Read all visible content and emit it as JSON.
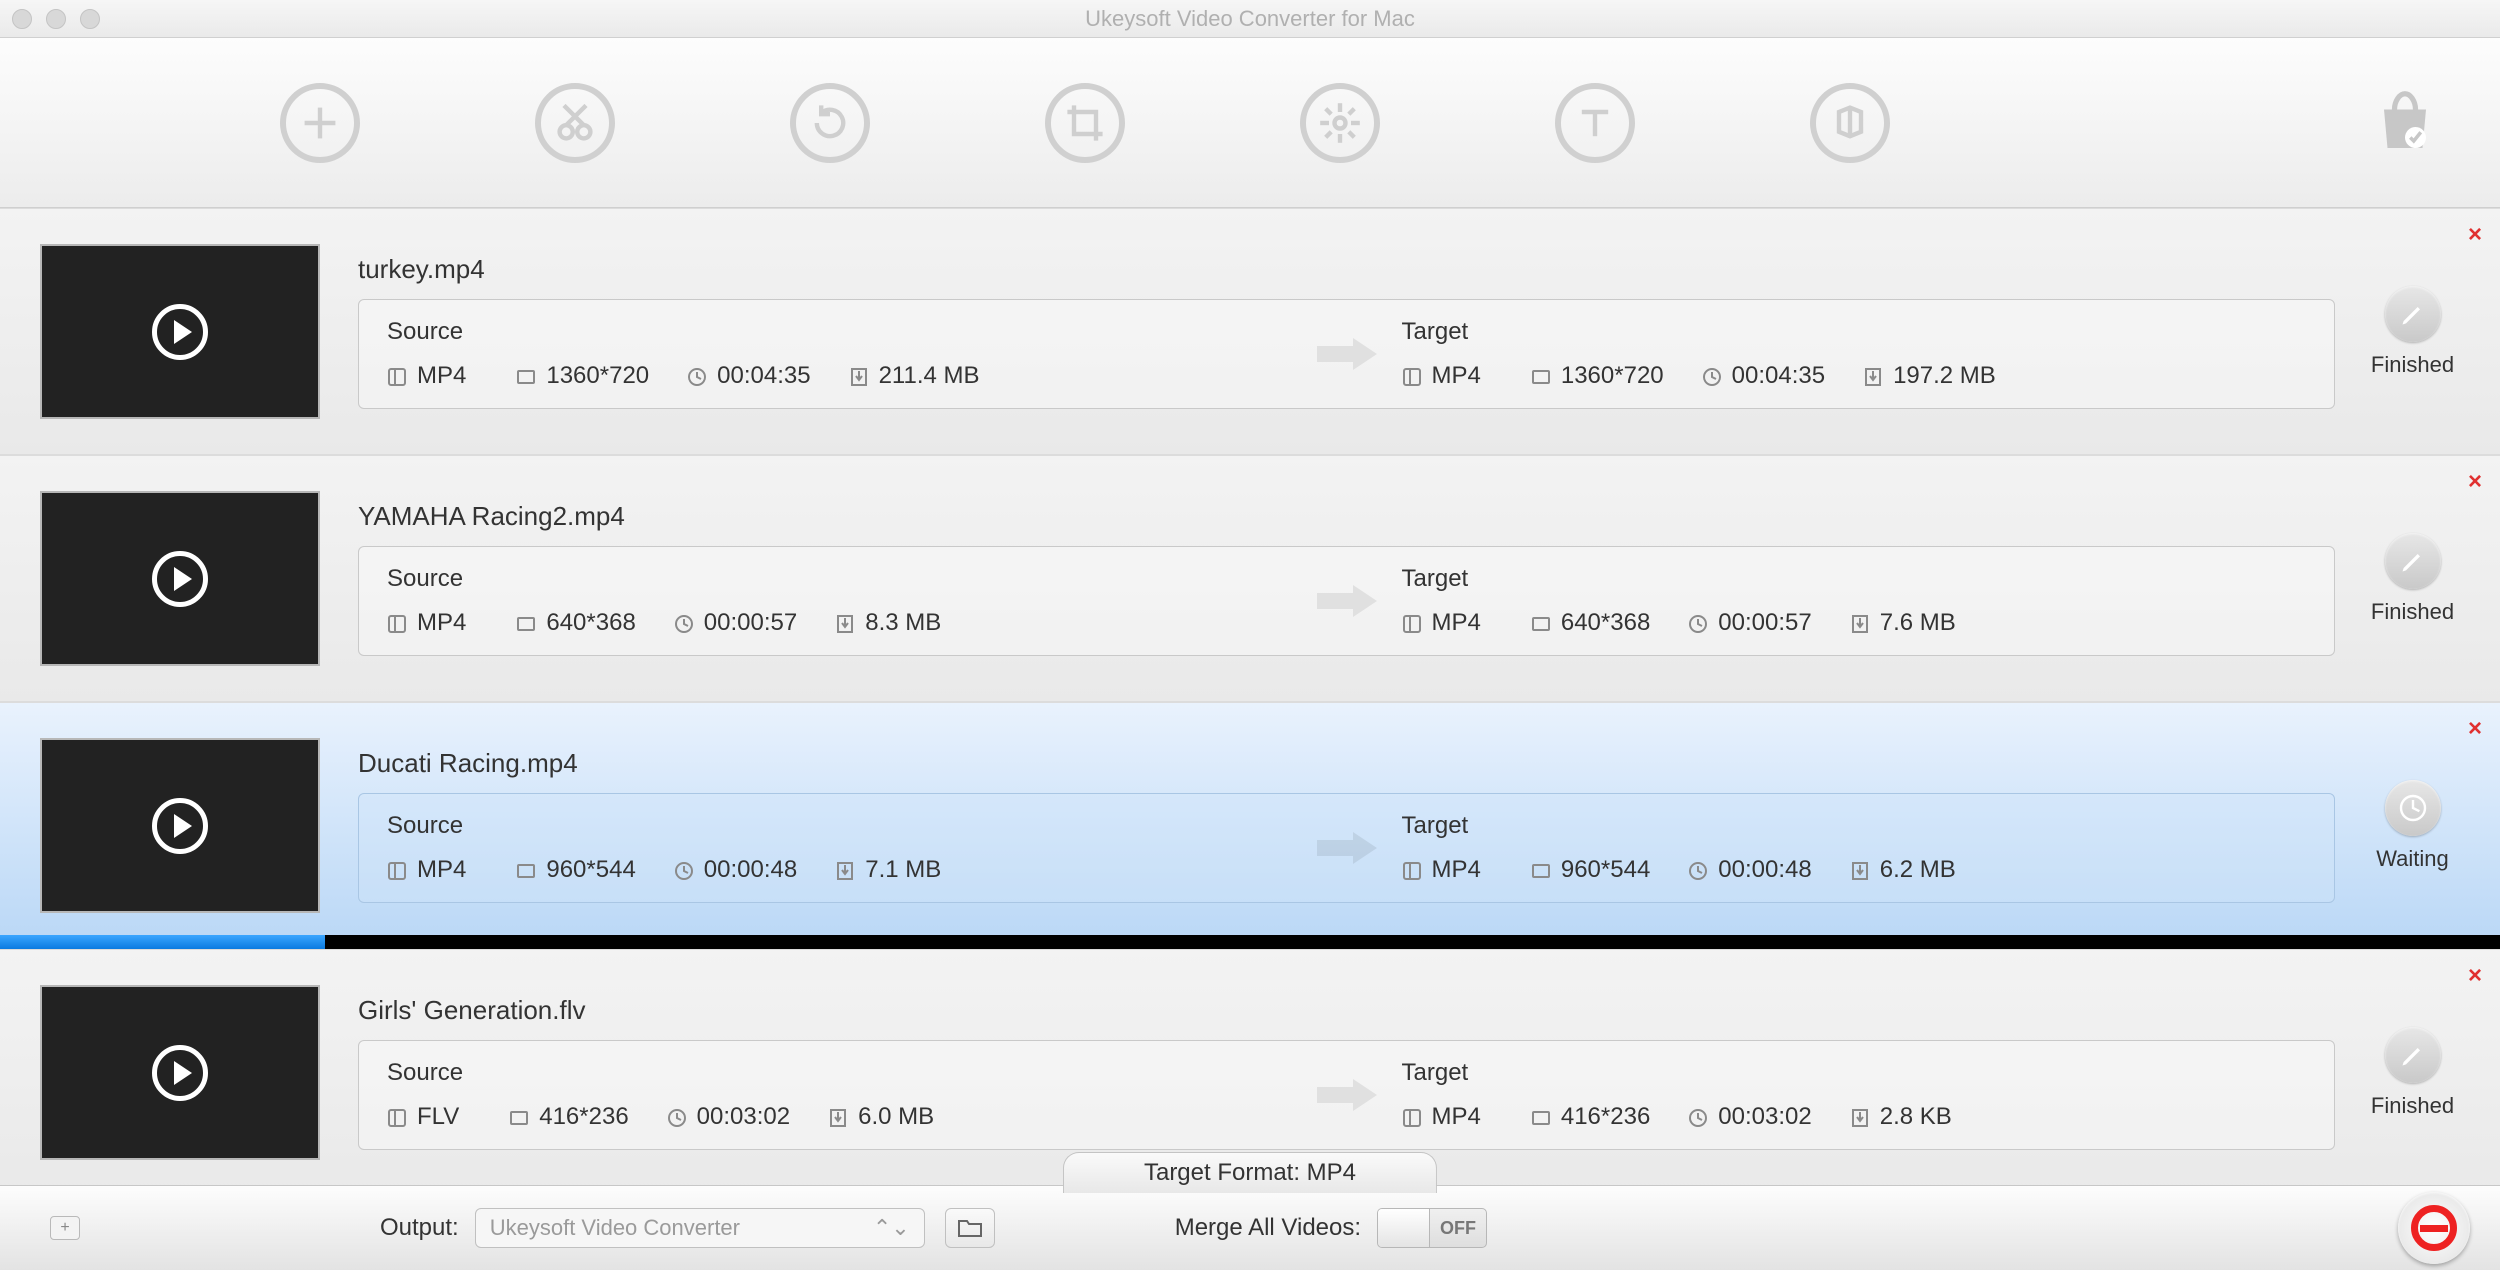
{
  "window": {
    "title": "Ukeysoft Video Converter for Mac"
  },
  "toolbar": {
    "icons": [
      "add",
      "trim",
      "rotate",
      "crop",
      "effects",
      "text",
      "audio"
    ],
    "shop": "shop"
  },
  "labels": {
    "source": "Source",
    "target": "Target",
    "finished": "Finished",
    "waiting": "Waiting",
    "output": "Output:",
    "merge": "Merge All Videos:",
    "off": "OFF",
    "target_format": "Target Format: MP4"
  },
  "output_select": "Ukeysoft Video Converter",
  "items": [
    {
      "name": "turkey.mp4",
      "thumb": "t0",
      "source": {
        "format": "MP4",
        "res": "1360*720",
        "dur": "00:04:35",
        "size": "211.4 MB"
      },
      "target": {
        "format": "MP4",
        "res": "1360*720",
        "dur": "00:04:35",
        "size": "197.2 MB"
      },
      "status": "Finished",
      "selected": false,
      "progress": null
    },
    {
      "name": "YAMAHA Racing2.mp4",
      "thumb": "t1",
      "source": {
        "format": "MP4",
        "res": "640*368",
        "dur": "00:00:57",
        "size": "8.3 MB"
      },
      "target": {
        "format": "MP4",
        "res": "640*368",
        "dur": "00:00:57",
        "size": "7.6 MB"
      },
      "status": "Finished",
      "selected": false,
      "progress": null
    },
    {
      "name": "Ducati Racing.mp4",
      "thumb": "t2",
      "source": {
        "format": "MP4",
        "res": "960*544",
        "dur": "00:00:48",
        "size": "7.1 MB"
      },
      "target": {
        "format": "MP4",
        "res": "960*544",
        "dur": "00:00:48",
        "size": "6.2 MB"
      },
      "status": "Waiting",
      "selected": true,
      "progress": 13
    },
    {
      "name": "Girls' Generation.flv",
      "thumb": "t3",
      "source": {
        "format": "FLV",
        "res": "416*236",
        "dur": "00:03:02",
        "size": "6.0 MB"
      },
      "target": {
        "format": "MP4",
        "res": "416*236",
        "dur": "00:03:02",
        "size": "2.8 KB"
      },
      "status": "Finished",
      "selected": false,
      "progress": null
    }
  ]
}
